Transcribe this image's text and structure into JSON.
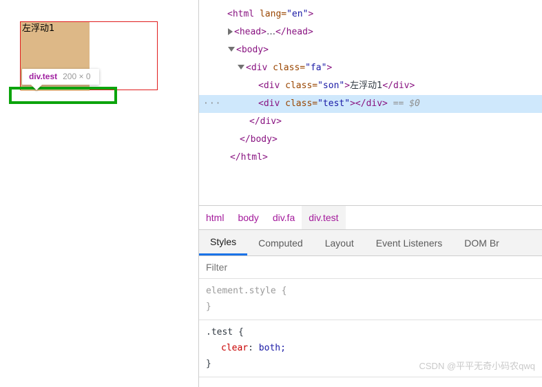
{
  "preview": {
    "parent_div": {
      "name": "div.fa",
      "border_color": "#e01b1b"
    },
    "floated_div": {
      "text": "左浮动1",
      "background": "#ddb887"
    },
    "highlight_box": {
      "color": "#0ca40c"
    },
    "tooltip": {
      "tag": "div.test",
      "dimensions": "200 × 0"
    }
  },
  "dom_tree": {
    "rows": [
      {
        "indent": 10,
        "marker": "none",
        "parts": [
          {
            "t": "punct",
            "v": "<"
          },
          {
            "t": "tag",
            "v": "html"
          },
          {
            "t": "space",
            "v": " "
          },
          {
            "t": "attrn",
            "v": "lang"
          },
          {
            "t": "punct_plain",
            "v": "="
          },
          {
            "t": "attrv",
            "v": "\"en\""
          },
          {
            "t": "punct",
            "v": ">"
          }
        ]
      },
      {
        "indent": 20,
        "marker": "closed",
        "parts": [
          {
            "t": "punct",
            "v": "<"
          },
          {
            "t": "tag",
            "v": "head"
          },
          {
            "t": "punct",
            "v": ">"
          },
          {
            "t": "txt",
            "v": "…"
          },
          {
            "t": "punct",
            "v": "</"
          },
          {
            "t": "tag",
            "v": "head"
          },
          {
            "t": "punct",
            "v": ">"
          }
        ]
      },
      {
        "indent": 20,
        "marker": "open",
        "parts": [
          {
            "t": "punct",
            "v": "<"
          },
          {
            "t": "tag",
            "v": "body"
          },
          {
            "t": "punct",
            "v": ">"
          }
        ]
      },
      {
        "indent": 34,
        "marker": "open",
        "parts": [
          {
            "t": "punct",
            "v": "<"
          },
          {
            "t": "tag",
            "v": "div"
          },
          {
            "t": "space",
            "v": " "
          },
          {
            "t": "attrn",
            "v": "class"
          },
          {
            "t": "punct_plain",
            "v": "="
          },
          {
            "t": "attrv",
            "v": "\"fa\""
          },
          {
            "t": "punct",
            "v": ">"
          }
        ]
      },
      {
        "indent": 55,
        "marker": "none",
        "parts": [
          {
            "t": "punct",
            "v": "<"
          },
          {
            "t": "tag",
            "v": "div"
          },
          {
            "t": "space",
            "v": " "
          },
          {
            "t": "attrn",
            "v": "class"
          },
          {
            "t": "punct_plain",
            "v": "="
          },
          {
            "t": "attrv",
            "v": "\"son\""
          },
          {
            "t": "punct",
            "v": ">"
          },
          {
            "t": "txt",
            "v": "左浮动1"
          },
          {
            "t": "punct",
            "v": "</"
          },
          {
            "t": "tag",
            "v": "div"
          },
          {
            "t": "punct",
            "v": ">"
          }
        ]
      },
      {
        "indent": 55,
        "marker": "none",
        "selected": true,
        "ellipsis": "···",
        "parts": [
          {
            "t": "punct",
            "v": "<"
          },
          {
            "t": "tag",
            "v": "div"
          },
          {
            "t": "space",
            "v": " "
          },
          {
            "t": "attrn",
            "v": "class"
          },
          {
            "t": "punct_plain",
            "v": "="
          },
          {
            "t": "attrv",
            "v": "\"test\""
          },
          {
            "t": "punct",
            "v": ">"
          },
          {
            "t": "punct",
            "v": "</"
          },
          {
            "t": "tag",
            "v": "div"
          },
          {
            "t": "punct",
            "v": ">"
          },
          {
            "t": "eq",
            "v": " == "
          },
          {
            "t": "dollar",
            "v": "$0"
          }
        ]
      },
      {
        "indent": 42,
        "marker": "none",
        "parts": [
          {
            "t": "punct",
            "v": "</"
          },
          {
            "t": "tag",
            "v": "div"
          },
          {
            "t": "punct",
            "v": ">"
          }
        ]
      },
      {
        "indent": 28,
        "marker": "none",
        "parts": [
          {
            "t": "punct",
            "v": "</"
          },
          {
            "t": "tag",
            "v": "body"
          },
          {
            "t": "punct",
            "v": ">"
          }
        ]
      },
      {
        "indent": 14,
        "marker": "none",
        "parts": [
          {
            "t": "punct",
            "v": "</"
          },
          {
            "t": "tag",
            "v": "html"
          },
          {
            "t": "punct",
            "v": ">"
          }
        ]
      }
    ]
  },
  "breadcrumb": {
    "items": [
      {
        "label": "html",
        "active": false
      },
      {
        "label": "body",
        "active": false
      },
      {
        "label": "div.fa",
        "active": false
      },
      {
        "label": "div.test",
        "active": true
      }
    ]
  },
  "panel_tabs": {
    "items": [
      {
        "label": "Styles",
        "active": true
      },
      {
        "label": "Computed",
        "active": false
      },
      {
        "label": "Layout",
        "active": false
      },
      {
        "label": "Event Listeners",
        "active": false
      },
      {
        "label": "DOM Br",
        "active": false
      }
    ],
    "accent": "#1a73e8"
  },
  "filter": {
    "placeholder": "Filter",
    "value": ""
  },
  "style_rules": [
    {
      "selector": "element.style",
      "selector_muted": true,
      "declarations": []
    },
    {
      "selector": ".test",
      "selector_muted": false,
      "declarations": [
        {
          "property": "clear",
          "value": "both"
        }
      ]
    }
  ],
  "watermark": {
    "text": "CSDN @平平无奇小码农qwq"
  }
}
